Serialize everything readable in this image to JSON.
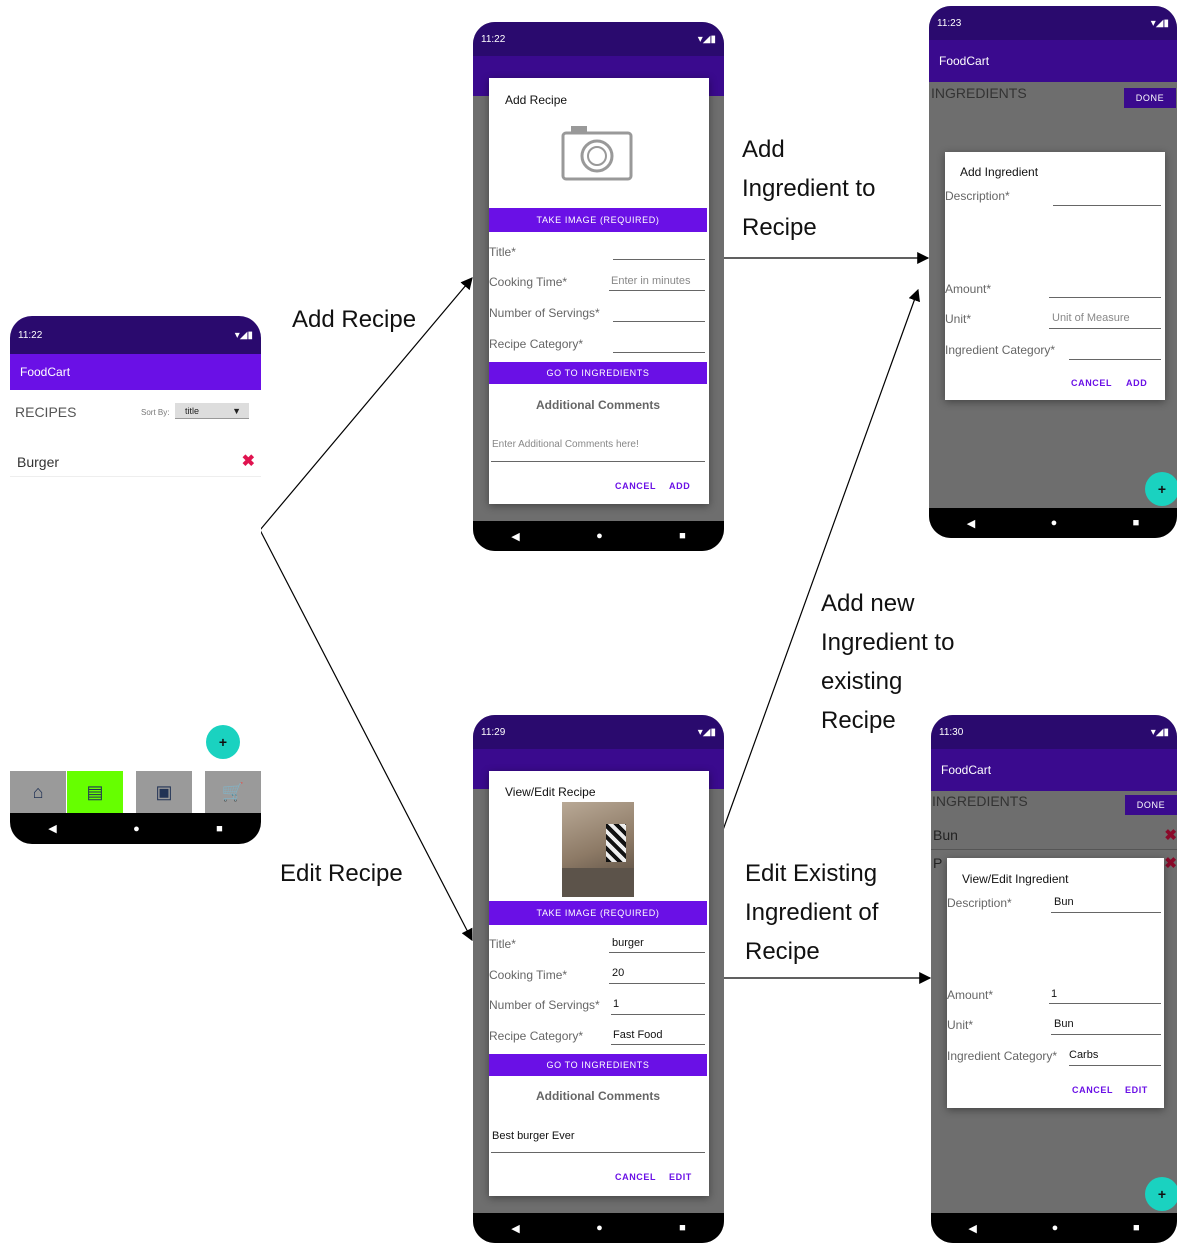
{
  "phone_main": {
    "status_time": "11:22",
    "app_title": "FoodCart",
    "section_title": "RECIPES",
    "sort_label": "Sort By:",
    "sort_value": "title",
    "recipe_item": "Burger",
    "fab_label": "+"
  },
  "phone_add_recipe": {
    "status_time": "11:22",
    "dialog_title": "Add Recipe",
    "take_image": "TAKE IMAGE (REQUIRED)",
    "fields": [
      {
        "label": "Title*",
        "value": ""
      },
      {
        "label": "Cooking Time*",
        "value": "Enter in minutes"
      },
      {
        "label": "Number of Servings*",
        "value": ""
      },
      {
        "label": "Recipe Category*",
        "value": ""
      }
    ],
    "go_to_ingredients": "GO TO INGREDIENTS",
    "comments_title": "Additional Comments",
    "comments_placeholder": "Enter Additional Comments here!",
    "cancel": "CANCEL",
    "confirm": "ADD"
  },
  "phone_edit_recipe": {
    "status_time": "11:29",
    "dialog_title": "View/Edit Recipe",
    "take_image": "TAKE IMAGE (REQUIRED)",
    "fields": [
      {
        "label": "Title*",
        "value": "burger"
      },
      {
        "label": "Cooking Time*",
        "value": "20"
      },
      {
        "label": "Number of Servings*",
        "value": "1"
      },
      {
        "label": "Recipe Category*",
        "value": "Fast Food"
      }
    ],
    "go_to_ingredients": "GO TO INGREDIENTS",
    "comments_title": "Additional Comments",
    "comments_value": "Best burger Ever",
    "cancel": "CANCEL",
    "confirm": "EDIT"
  },
  "phone_add_ingredient": {
    "status_time": "11:23",
    "app_title": "FoodCart",
    "section_title": "INGREDIENTS",
    "done": "DONE",
    "dialog_title": "Add Ingredient",
    "fields": [
      {
        "label": "Description*",
        "value": ""
      },
      {
        "label": "Amount*",
        "value": ""
      },
      {
        "label": "Unit*",
        "value": "Unit of Measure"
      },
      {
        "label": "Ingredient Category*",
        "value": ""
      }
    ],
    "cancel": "CANCEL",
    "confirm": "ADD",
    "fab_label": "+"
  },
  "phone_edit_ingredient": {
    "status_time": "11:30",
    "app_title": "FoodCart",
    "section_title": "INGREDIENTS",
    "done": "DONE",
    "list_items": [
      "Bun",
      "P"
    ],
    "dialog_title": "View/Edit Ingredient",
    "fields": [
      {
        "label": "Description*",
        "value": "Bun"
      },
      {
        "label": "Amount*",
        "value": "1"
      },
      {
        "label": "Unit*",
        "value": "Bun"
      },
      {
        "label": "Ingredient Category*",
        "value": "Carbs"
      }
    ],
    "cancel": "CANCEL",
    "confirm": "EDIT",
    "fab_label": "+"
  },
  "flow_labels": {
    "add_recipe": "Add Recipe",
    "edit_recipe": "Edit Recipe",
    "add_ingredient_line1": "Add",
    "add_ingredient_line2": "Ingredient to",
    "add_ingredient_line3": "Recipe",
    "add_new_line1": "Add new",
    "add_new_line2": "Ingredient to",
    "add_new_line3": "existing",
    "add_new_line4": "Recipe",
    "edit_existing_line1": "Edit Existing",
    "edit_existing_line2": "Ingredient of",
    "edit_existing_line3": "Recipe"
  },
  "colors": {
    "status_bar": "#2a0a6e",
    "app_bar": "#6a10e6",
    "accent_button": "#6a10e6",
    "fab": "#1ad2c0",
    "active_tab": "#66ff00",
    "delete_icon": "#e0134f"
  }
}
